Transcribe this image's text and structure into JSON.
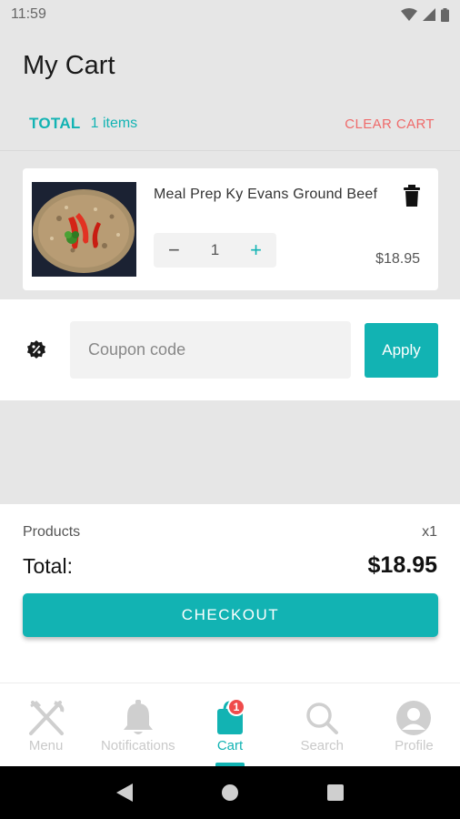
{
  "status_bar": {
    "time": "11:59"
  },
  "header": {
    "title": "My Cart",
    "total_label": "TOTAL",
    "items_count": "1 items",
    "clear_cart": "CLEAR CART"
  },
  "cart_items": [
    {
      "name": "Meal Prep Ky Evans Ground Beef",
      "quantity": "1",
      "price": "$18.95",
      "decrement": "−",
      "increment": "+"
    }
  ],
  "coupon": {
    "placeholder": "Coupon code",
    "value": "",
    "apply_label": "Apply"
  },
  "totals": {
    "products_label": "Products",
    "products_count": "x1",
    "total_label": "Total:",
    "total_amount": "$18.95",
    "checkout_label": "CHECKOUT"
  },
  "bottom_nav": {
    "items": [
      {
        "label": "Menu",
        "icon": "utensils-icon"
      },
      {
        "label": "Notifications",
        "icon": "bell-icon"
      },
      {
        "label": "Cart",
        "icon": "shopping-bag-icon",
        "badge": "1",
        "active": true
      },
      {
        "label": "Search",
        "icon": "search-icon"
      },
      {
        "label": "Profile",
        "icon": "user-circle-icon"
      }
    ]
  },
  "colors": {
    "accent": "#12b3b3",
    "danger": "#ef6a6a",
    "badge": "#ef4b4b"
  }
}
